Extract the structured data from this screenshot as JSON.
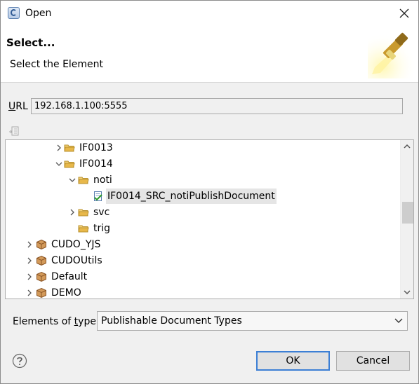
{
  "window": {
    "title": "Open"
  },
  "header": {
    "title": "Select...",
    "message": "Select the Element"
  },
  "url": {
    "label_first": "U",
    "label_rest": "RL",
    "value": "192.168.1.100:5555"
  },
  "tree": {
    "rows": [
      {
        "label": "IF0013",
        "icon": "folder-icon",
        "twisty": "collapsed"
      },
      {
        "label": "IF0014",
        "icon": "folder-icon",
        "twisty": "expanded"
      },
      {
        "label": "noti",
        "icon": "folder-icon",
        "twisty": "expanded"
      },
      {
        "label": "IF0014_SRC_notiPublishDocument",
        "icon": "document-type-icon",
        "twisty": "none",
        "selected": true
      },
      {
        "label": "svc",
        "icon": "folder-icon",
        "twisty": "collapsed"
      },
      {
        "label": "trig",
        "icon": "folder-icon",
        "twisty": "none"
      },
      {
        "label": "CUDO_YJS",
        "icon": "package-icon",
        "twisty": "collapsed"
      },
      {
        "label": "CUDOUtils",
        "icon": "package-icon",
        "twisty": "collapsed"
      },
      {
        "label": "Default",
        "icon": "package-icon",
        "twisty": "collapsed"
      },
      {
        "label": "DEMO",
        "icon": "package-icon",
        "twisty": "collapsed"
      }
    ]
  },
  "type_filter": {
    "label_prefix": "Elements of ",
    "label_underlined": "t",
    "label_suffix": "ype:",
    "selected": "Publishable Document Types"
  },
  "buttons": {
    "ok": "OK",
    "cancel": "Cancel"
  },
  "colors": {
    "folder": "#e8b84a",
    "package": "#c8834a",
    "accent": "#3c7fd5"
  }
}
